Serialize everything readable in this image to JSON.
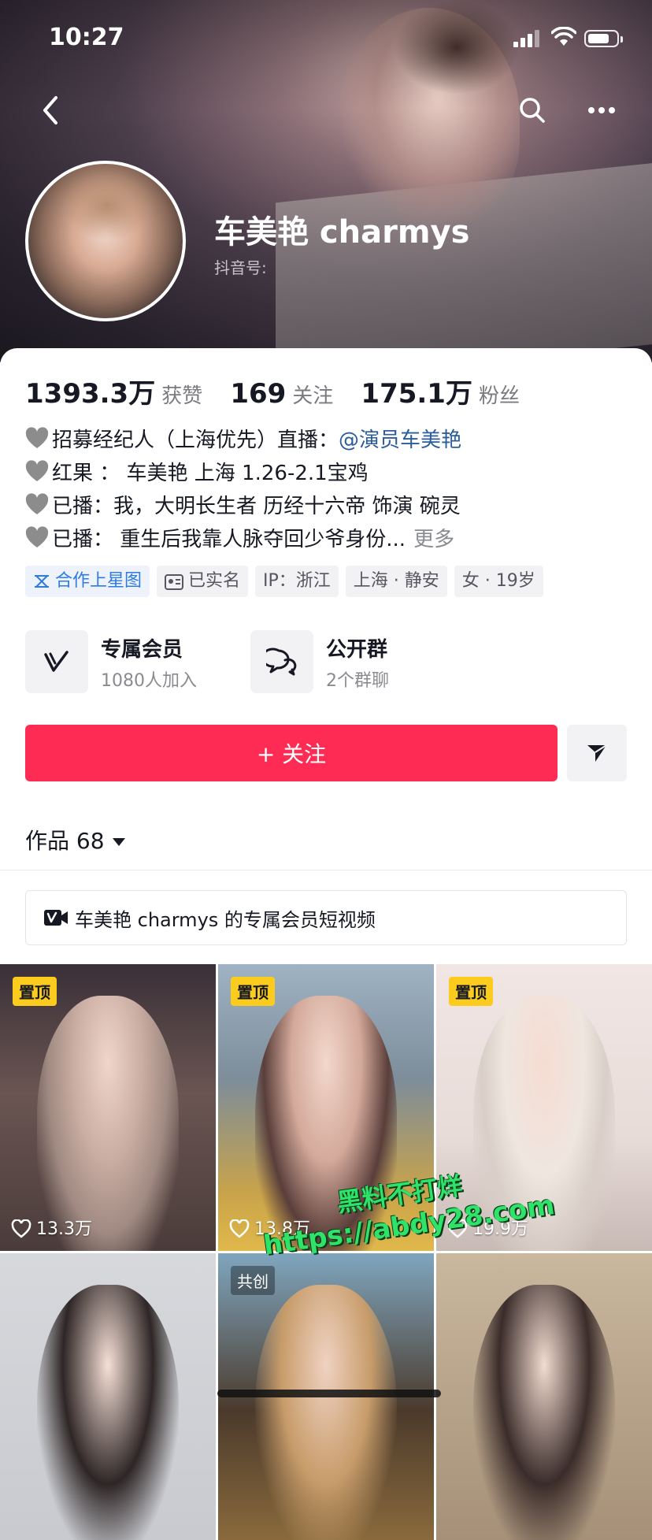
{
  "status_bar": {
    "time": "10:27"
  },
  "profile": {
    "nickname": "车美艳 charmys",
    "douyin_id_label": "抖音号:"
  },
  "stats": [
    {
      "value": "1393.3万",
      "label": "获赞"
    },
    {
      "value": "169",
      "label": "关注"
    },
    {
      "value": "175.1万",
      "label": "粉丝"
    }
  ],
  "bio": {
    "line1_text": "招募经纪人（上海优先）直播：",
    "line1_mention": "@演员车美艳",
    "line2": "红果 ： 车美艳 上海  1.26-2.1宝鸡",
    "line3": "已播：我，大明长生者 历经十六帝 饰演 碗灵",
    "line4": "已播： 重生后我靠人脉夺回少爷身份...",
    "more": "更多"
  },
  "tags": [
    {
      "label": "合作上星图",
      "icon": "star-map-icon"
    },
    {
      "label": "已实名",
      "icon": "id-card-icon"
    },
    {
      "label": "IP：浙江"
    },
    {
      "label": "上海 · 静安"
    },
    {
      "label": "女 · 19岁"
    }
  ],
  "membership": {
    "title": "专属会员",
    "subtitle": "1080人加入"
  },
  "group": {
    "title": "公开群",
    "subtitle": "2个群聊"
  },
  "follow_label": "+ 关注",
  "works_tab": {
    "label": "作品 68"
  },
  "exclusive_banner": "车美艳 charmys 的专属会员短视频",
  "videos": [
    {
      "badge": "置顶",
      "likes": "13.3万"
    },
    {
      "badge": "置顶",
      "likes": "13.8万"
    },
    {
      "badge": "置顶",
      "likes": "19.9万"
    },
    {
      "badge": "",
      "likes": ""
    },
    {
      "badge": "共创",
      "likes": ""
    },
    {
      "badge": "",
      "likes": ""
    }
  ],
  "watermark": {
    "line1": "黑料不打烊",
    "line2": "https://abdy28.com"
  },
  "colors": {
    "accent": "#fe2c55",
    "pin_badge": "#fbcc1d",
    "mention": "#2b5d9b"
  }
}
